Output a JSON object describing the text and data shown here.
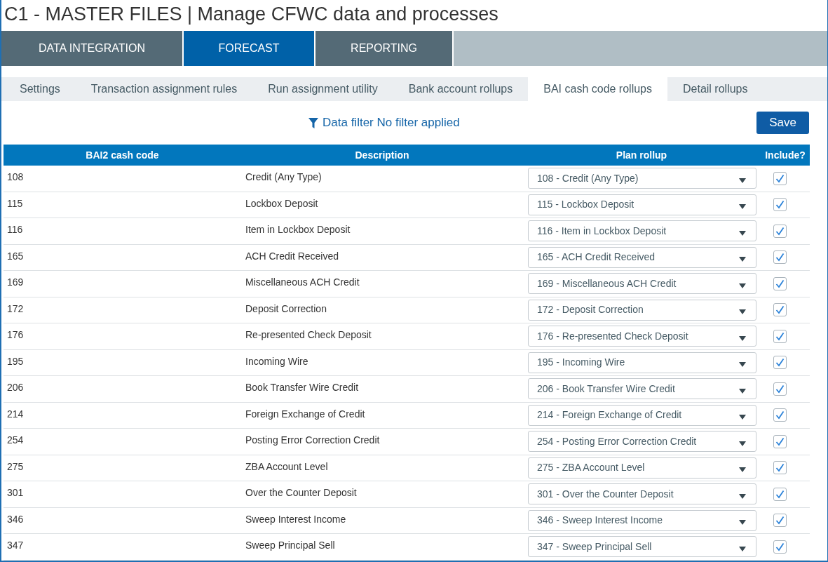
{
  "page_title": "C1 - MASTER FILES | Manage CFWC data and processes",
  "main_tabs": [
    {
      "label": "DATA INTEGRATION",
      "selected": false
    },
    {
      "label": "FORECAST",
      "selected": true
    },
    {
      "label": "REPORTING",
      "selected": false
    }
  ],
  "sub_tabs": [
    {
      "label": "Settings",
      "selected": false
    },
    {
      "label": "Transaction assignment rules",
      "selected": false
    },
    {
      "label": "Run assignment utility",
      "selected": false
    },
    {
      "label": "Bank account rollups",
      "selected": false
    },
    {
      "label": "BAI cash code rollups",
      "selected": true
    },
    {
      "label": "Detail rollups",
      "selected": false
    }
  ],
  "filter": {
    "label": "Data filter",
    "value": "No filter applied"
  },
  "save_button": "Save",
  "table": {
    "columns": [
      "BAI2 cash code",
      "Description",
      "Plan rollup",
      "Include?"
    ],
    "rows": [
      {
        "code": "108",
        "description": "Credit (Any Type)",
        "plan_rollup": "108 - Credit (Any Type)",
        "include": true
      },
      {
        "code": "115",
        "description": "Lockbox Deposit",
        "plan_rollup": "115 - Lockbox Deposit",
        "include": true
      },
      {
        "code": "116",
        "description": "Item in Lockbox Deposit",
        "plan_rollup": "116 - Item in Lockbox Deposit",
        "include": true
      },
      {
        "code": "165",
        "description": "ACH Credit Received",
        "plan_rollup": "165 - ACH Credit Received",
        "include": true
      },
      {
        "code": "169",
        "description": "Miscellaneous ACH Credit",
        "plan_rollup": "169 - Miscellaneous ACH Credit",
        "include": true
      },
      {
        "code": "172",
        "description": "Deposit Correction",
        "plan_rollup": "172 - Deposit Correction",
        "include": true
      },
      {
        "code": "176",
        "description": "Re-presented Check Deposit",
        "plan_rollup": "176 - Re-presented Check Deposit",
        "include": true
      },
      {
        "code": "195",
        "description": "Incoming Wire",
        "plan_rollup": "195 - Incoming Wire",
        "include": true
      },
      {
        "code": "206",
        "description": "Book Transfer Wire Credit",
        "plan_rollup": "206 - Book Transfer Wire Credit",
        "include": true
      },
      {
        "code": "214",
        "description": "Foreign Exchange of Credit",
        "plan_rollup": "214 - Foreign Exchange of Credit",
        "include": true
      },
      {
        "code": "254",
        "description": "Posting Error Correction Credit",
        "plan_rollup": "254 - Posting Error Correction Credit",
        "include": true
      },
      {
        "code": "275",
        "description": "ZBA Account Level",
        "plan_rollup": "275 - ZBA Account Level",
        "include": true
      },
      {
        "code": "301",
        "description": "Over the Counter Deposit",
        "plan_rollup": "301 - Over the Counter Deposit",
        "include": true
      },
      {
        "code": "346",
        "description": "Sweep Interest Income",
        "plan_rollup": "346 - Sweep Interest Income",
        "include": true
      },
      {
        "code": "347",
        "description": "Sweep Principal Sell",
        "plan_rollup": "347 - Sweep Principal Sell",
        "include": true
      }
    ]
  }
}
